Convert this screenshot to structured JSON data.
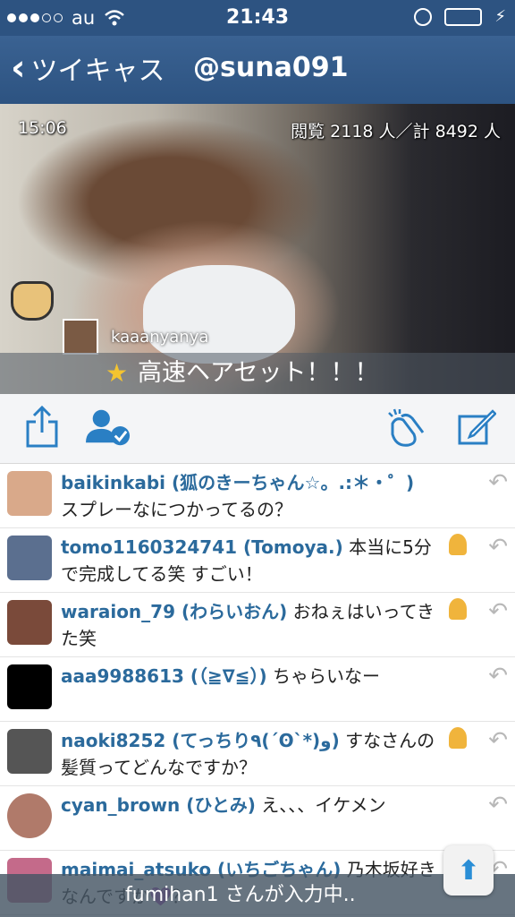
{
  "status_bar": {
    "carrier": "au",
    "time": "21:43",
    "signal_dots": 5,
    "signal_filled": 3,
    "battery_level": 1.0
  },
  "nav": {
    "back_label": "ツイキャス",
    "title": "@suna091"
  },
  "video": {
    "elapsed": "15:06",
    "views": "閲覧 2118 人／計 8492 人",
    "commenter": "kaaanyanya",
    "banner": "高速ヘアセット！！！"
  },
  "toolbar": {
    "icons": [
      "share-icon",
      "follow-icon",
      "clap-icon",
      "compose-icon"
    ]
  },
  "comments": [
    {
      "user": "baikinkabi (狐のきーちゃん☆。.:＊・゜)",
      "text": "スプレーなにつかってるの？",
      "medal": false,
      "avatar_color": "#d9a98a"
    },
    {
      "user": "tomo1160324741 (Tomoya.)",
      "text": " 本当に5分で完成してる笑 すごい！",
      "medal": true,
      "avatar_color": "#5b6f8f"
    },
    {
      "user": "waraion_79 (わらいおん)",
      "text": " おねぇはいってきた笑",
      "medal": true,
      "avatar_color": "#7a4a3a"
    },
    {
      "user": "aaa9988613 (（≧∇≦）)",
      "text": " ちゃらいなー",
      "medal": false,
      "avatar_color": "#000000"
    },
    {
      "user": "naoki8252 (てっちり٩(´ʘ`*)و)",
      "text": " すなさんの髪質ってどんなですか？",
      "medal": true,
      "avatar_color": "#555555"
    },
    {
      "user": "cyan_brown (ひとみ)",
      "text": " え、、、イケメン",
      "medal": false,
      "avatar_color": "#b07a6a"
    },
    {
      "user": "maimai_atsuko (いちごちゃん)",
      "text": " 乃木坂好きなんですか💜？",
      "medal": false,
      "avatar_color": "#c46a8a"
    }
  ],
  "typing": "fumihan1 さんが入力中.."
}
